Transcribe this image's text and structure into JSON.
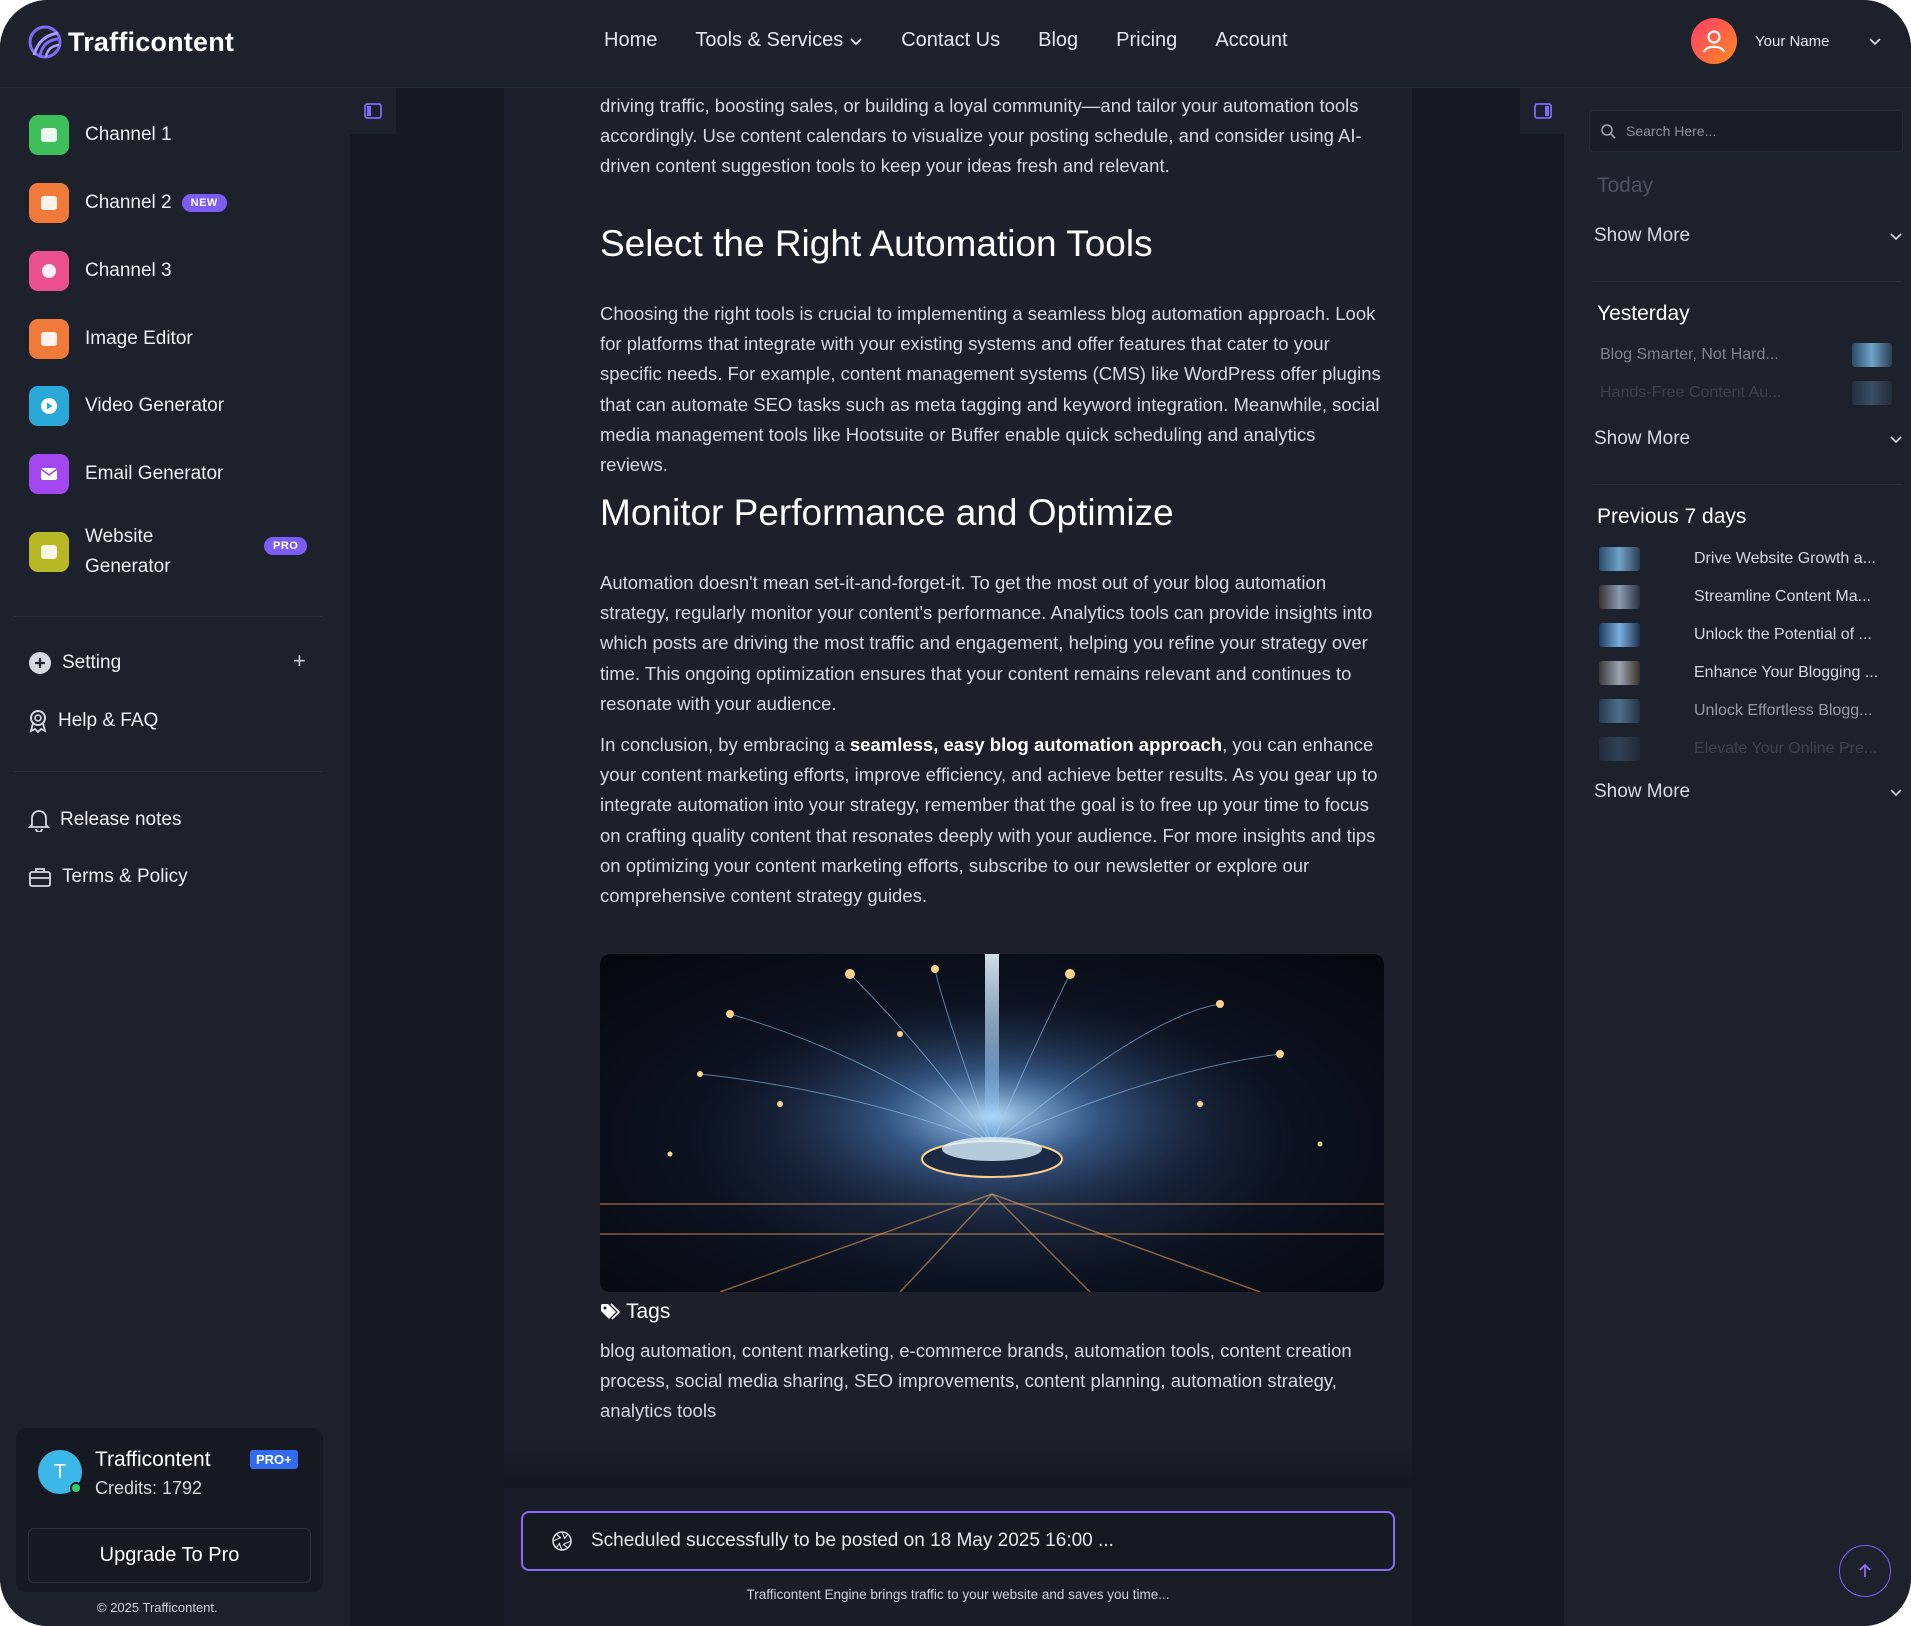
{
  "brand": {
    "name": "Trafficontent"
  },
  "nav": {
    "items": [
      {
        "label": "Home"
      },
      {
        "label": "Tools & Services",
        "dropdown": true
      },
      {
        "label": "Contact Us"
      },
      {
        "label": "Blog"
      },
      {
        "label": "Pricing"
      },
      {
        "label": "Account"
      }
    ]
  },
  "user": {
    "name": "Your Name"
  },
  "sidebar": {
    "items": [
      {
        "label": "Channel 1",
        "icon": "channel-icon",
        "color": "#3fbf5a"
      },
      {
        "label": "Channel 2",
        "icon": "channel-icon",
        "color": "#ef7a3a",
        "badge": "NEW"
      },
      {
        "label": "Channel 3",
        "icon": "channel-icon",
        "color": "#ec4f8e"
      },
      {
        "label": "Image Editor",
        "icon": "image-icon",
        "color": "#ef7a3a"
      },
      {
        "label": "Video Generator",
        "icon": "video-icon",
        "color": "#2aa8d8"
      },
      {
        "label": "Email Generator",
        "icon": "email-icon",
        "color": "#a347f0"
      },
      {
        "label_line1": "Website",
        "label_line2": "Generator",
        "icon": "website-icon",
        "color": "#b8b825",
        "badge": "PRO"
      }
    ],
    "setting": "Setting",
    "help": "Help & FAQ",
    "release_notes": "Release notes",
    "terms": "Terms & Policy",
    "card": {
      "avatar_letter": "T",
      "title": "Trafficontent",
      "badge": "PRO+",
      "credits": "Credits: 1792",
      "button": "Upgrade To Pro"
    },
    "copyright": "© 2025 Trafficontent."
  },
  "article": {
    "intro": "driving traffic, boosting sales, or building a loyal community—and tailor your automation tools accordingly. Use content calendars to visualize your posting schedule, and consider using AI-driven content suggestion tools to keep your ideas fresh and relevant.",
    "h1": "Select the Right Automation Tools",
    "p1": "Choosing the right tools is crucial to implementing a seamless blog automation approach. Look for platforms that integrate with your existing systems and offer features that cater to your specific needs. For example, content management systems (CMS) like WordPress offer plugins that can automate SEO tasks such as meta tagging and keyword integration. Meanwhile, social media management tools like Hootsuite or Buffer enable quick scheduling and analytics reviews.",
    "h2": "Monitor Performance and Optimize",
    "p2": "Automation doesn't mean set-it-and-forget-it. To get the most out of your blog automation strategy, regularly monitor your content's performance. Analytics tools can provide insights into which posts are driving the most traffic and engagement, helping you refine your strategy over time. This ongoing optimization ensures that your content remains relevant and continues to resonate with your audience.",
    "p3_before": "In conclusion, by embracing a ",
    "p3_bold": "seamless, easy blog automation approach",
    "p3_after": ", you can enhance your content marketing efforts, improve efficiency, and achieve better results. As you gear up to integrate automation into your strategy, remember that the goal is to free up your time to focus on crafting quality content that resonates deeply with your audience. For more insights and tips on optimizing your content marketing efforts, subscribe to our newsletter or explore our comprehensive content strategy guides.",
    "tags_title": "Tags",
    "tags": "blog automation, content marketing, e-commerce brands, automation tools, content creation process, social media sharing, SEO improvements, content planning, automation strategy, analytics tools"
  },
  "status": {
    "message": "Scheduled successfully to be posted on 18 May 2025 16:00 ..."
  },
  "footer": {
    "note": "Trafficontent Engine brings traffic to your website and saves you time..."
  },
  "history": {
    "search_placeholder": "Search Here...",
    "today": {
      "title": "Today",
      "show_more": "Show More"
    },
    "yesterday": {
      "title": "Yesterday",
      "items": [
        "Blog Smarter, Not Hard...",
        "Hands-Free Content Au..."
      ],
      "show_more": "Show More"
    },
    "previous": {
      "title": "Previous 7 days",
      "items": [
        "Drive Website Growth a...",
        "Streamline Content Ma...",
        "Unlock the Potential of ...",
        "Enhance Your Blogging ...",
        "Unlock Effortless Blogg...",
        "Elevate Your Online Pre..."
      ],
      "show_more": "Show More"
    }
  }
}
